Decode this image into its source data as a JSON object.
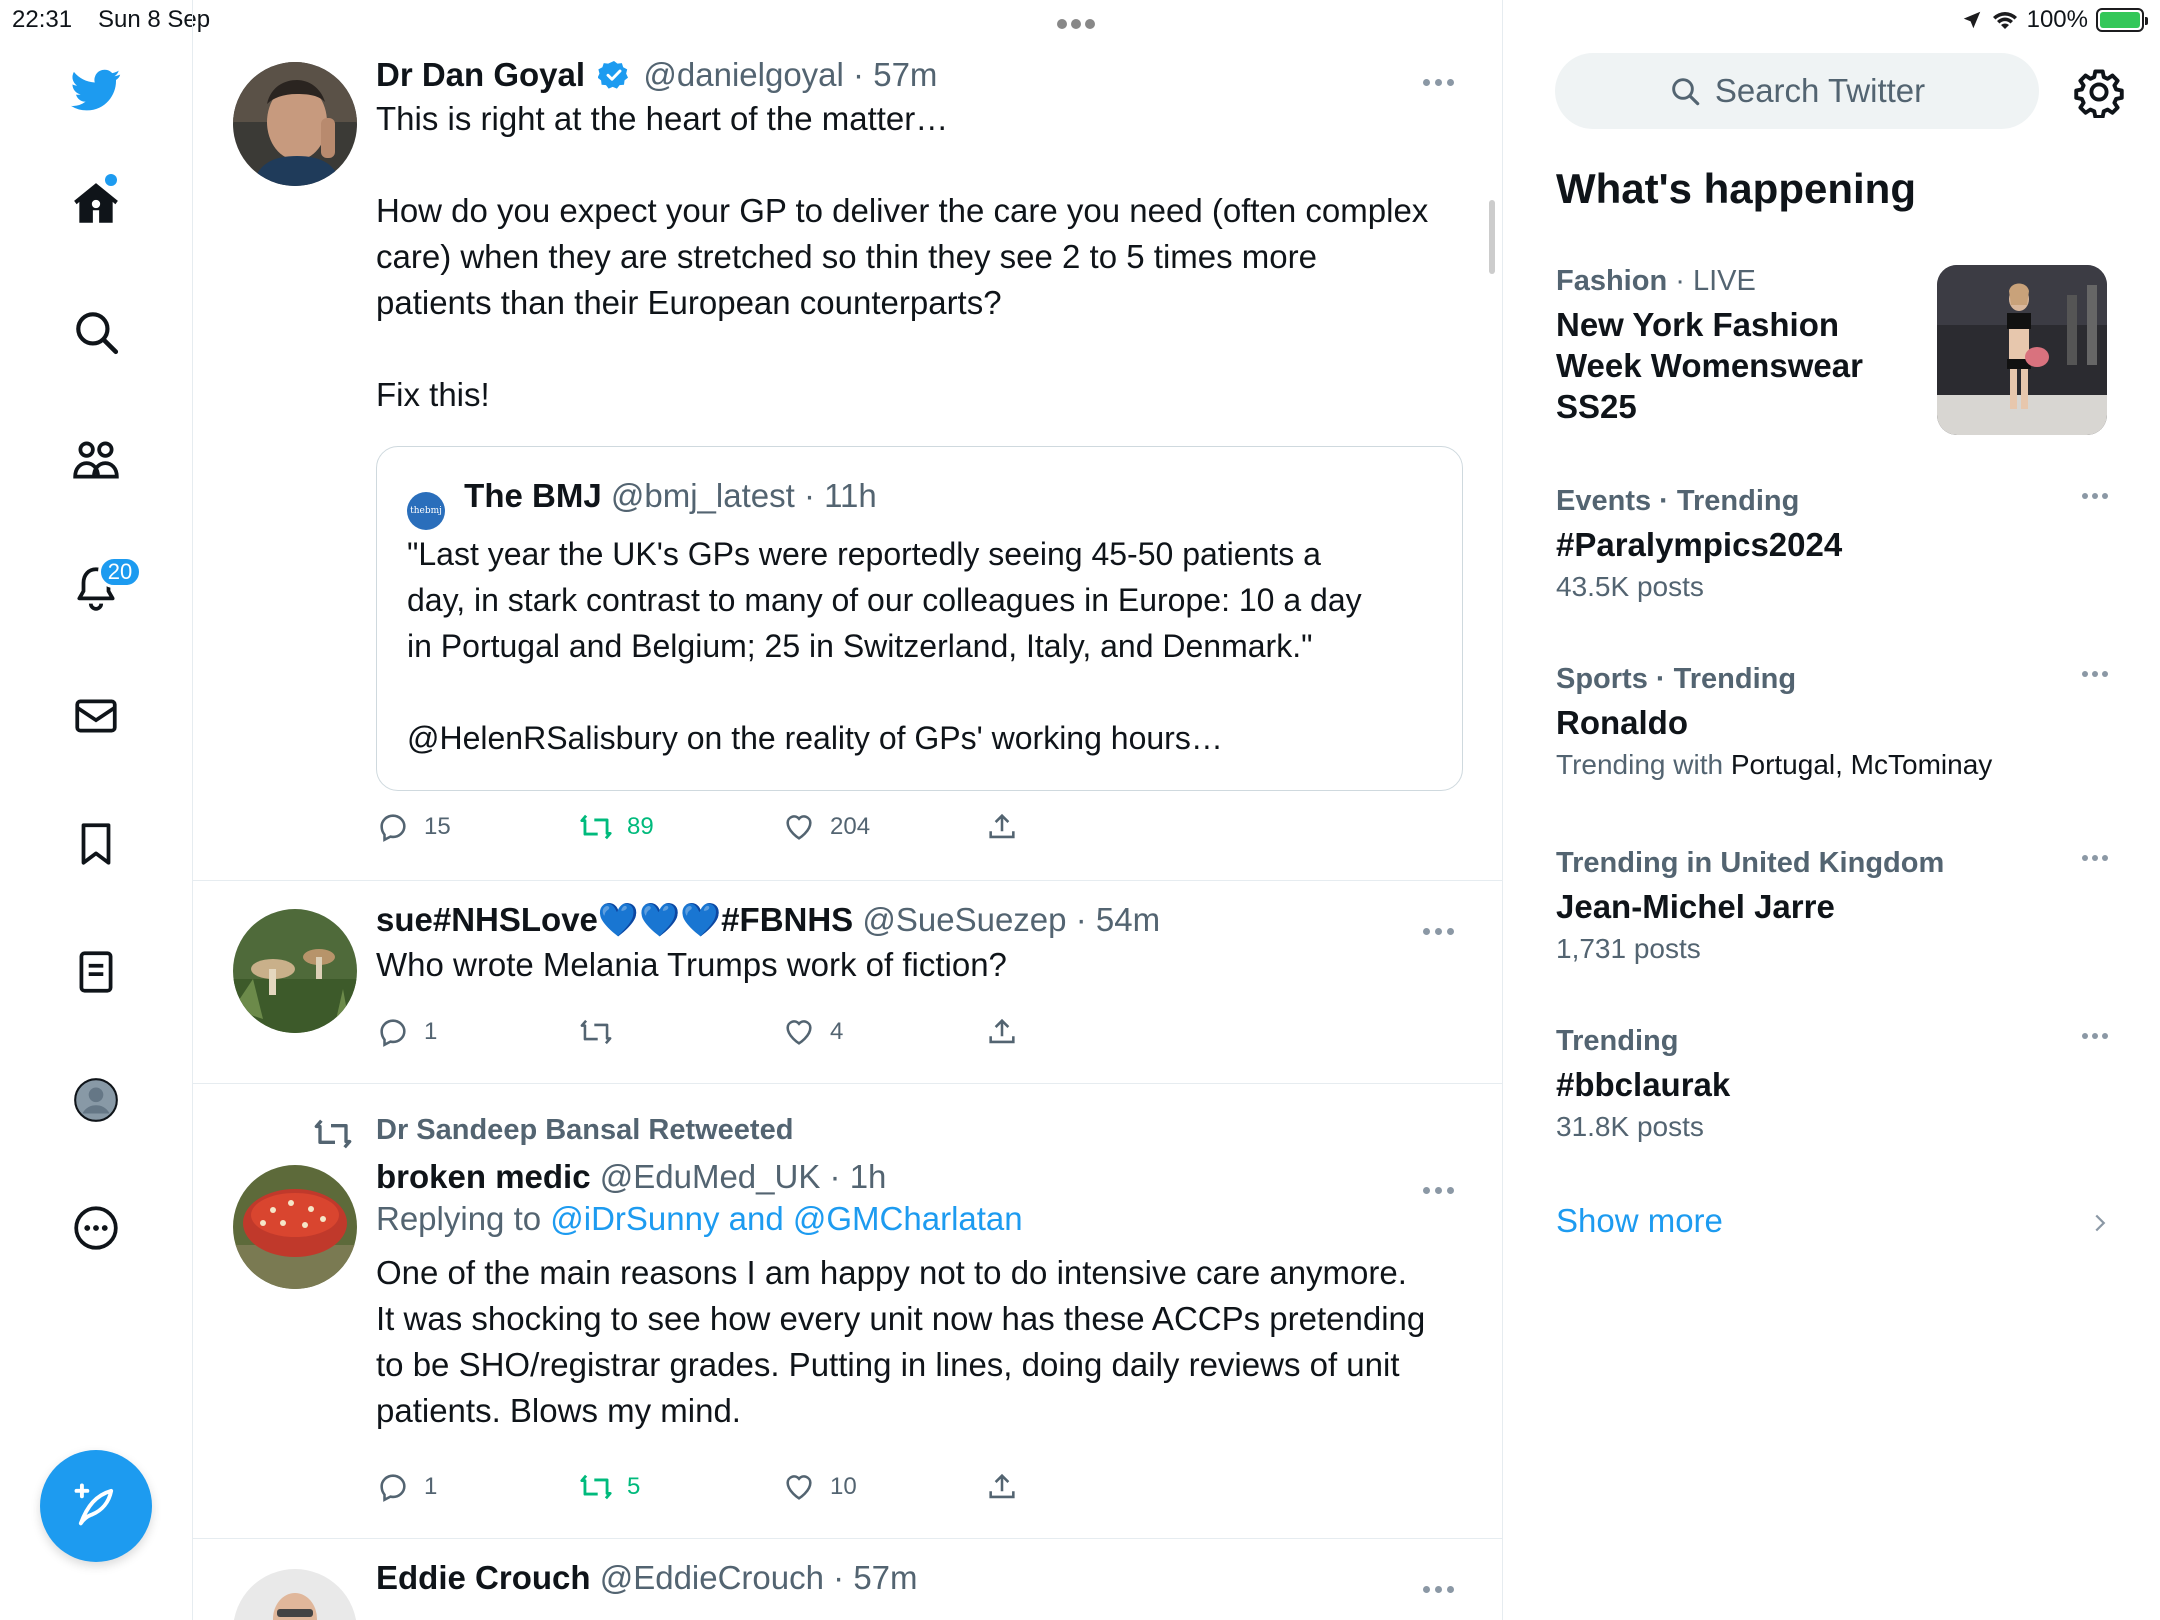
{
  "status_bar": {
    "time": "22:31",
    "date": "Sun 8 Sep",
    "battery": "100%"
  },
  "nav": {
    "notifications_count": "20",
    "icons": [
      "twitter-logo-icon",
      "home-icon",
      "search-icon",
      "communities-icon",
      "bell-icon",
      "mail-icon",
      "bookmark-icon",
      "lists-icon",
      "profile-icon",
      "more-circle-icon",
      "compose-icon"
    ]
  },
  "tweets": [
    {
      "name": "Dr Dan Goyal",
      "handle": "@danielgoyal",
      "sep": "·",
      "time": "57m",
      "verified": true,
      "body_lines": [
        "This is right at the heart of the matter…",
        "",
        "How do you expect your GP to deliver the care you need (often complex",
        "care) when they are stretched so thin they see 2 to 5 times more",
        "patients than their European counterparts?",
        "",
        "Fix this!"
      ],
      "quote": {
        "logo_text": "thebmj",
        "name": "The BMJ",
        "handle": "@bmj_latest",
        "sep": "·",
        "time": "11h",
        "body_lines": [
          "\"Last year the UK's GPs were reportedly seeing 45-50 patients a",
          "day, in stark contrast to many of our colleagues in Europe: 10 a day",
          "in Portugal and Belgium; 25 in Switzerland, Italy, and Denmark.\"",
          "",
          "@HelenRSalisbury on the reality of GPs' working hours…"
        ]
      },
      "replies": "15",
      "retweets": "89",
      "likes": "204"
    },
    {
      "name": "sue#NHSLove💙💙💙#FBNHS",
      "handle": "@SueSuezep",
      "sep": "·",
      "time": "54m",
      "body": "Who wrote  Melania Trumps work of fiction?",
      "replies": "1",
      "retweets": "",
      "likes": "4"
    },
    {
      "retweeted_by": "Dr Sandeep Bansal Retweeted",
      "name": "broken medic",
      "handle": "@EduMed_UK",
      "sep": "·",
      "time": "1h",
      "replying_prefix": "Replying to ",
      "replying_to": "@iDrSunny and @GMCharlatan",
      "body_lines": [
        "One of the main reasons I am happy not to do intensive care anymore.",
        "It was shocking to see how every unit now has these ACCPs pretending",
        "to be SHO/registrar grades. Putting in lines, doing daily reviews of unit",
        "patients. Blows my mind."
      ],
      "replies": "1",
      "retweets": "5",
      "likes": "10"
    },
    {
      "name": "Eddie Crouch",
      "handle": "@EddieCrouch",
      "sep": "·",
      "time": "57m"
    }
  ],
  "right": {
    "search_placeholder": "Search Twitter",
    "title": "What's happening",
    "trends": [
      {
        "category": "Fashion",
        "live": "· LIVE",
        "title_lines": [
          "New York Fashion",
          "Week Womenswear",
          "SS25"
        ]
      },
      {
        "category": "Events · Trending",
        "title": "#Paralympics2024",
        "sub": "43.5K posts"
      },
      {
        "category": "Sports · Trending",
        "title": "Ronaldo",
        "sub_prefix": "Trending with ",
        "sub_strong": "Portugal, McTominay"
      },
      {
        "category": "Trending in United Kingdom",
        "title": "Jean-Michel Jarre",
        "sub": "1,731 posts"
      },
      {
        "category": "Trending",
        "title": "#bbclaurak",
        "sub": "31.8K posts"
      }
    ],
    "show_more": "Show more"
  },
  "colors": {
    "accent": "#1d9bf0",
    "retweet_green": "#00ba7c",
    "muted": "#536471"
  }
}
